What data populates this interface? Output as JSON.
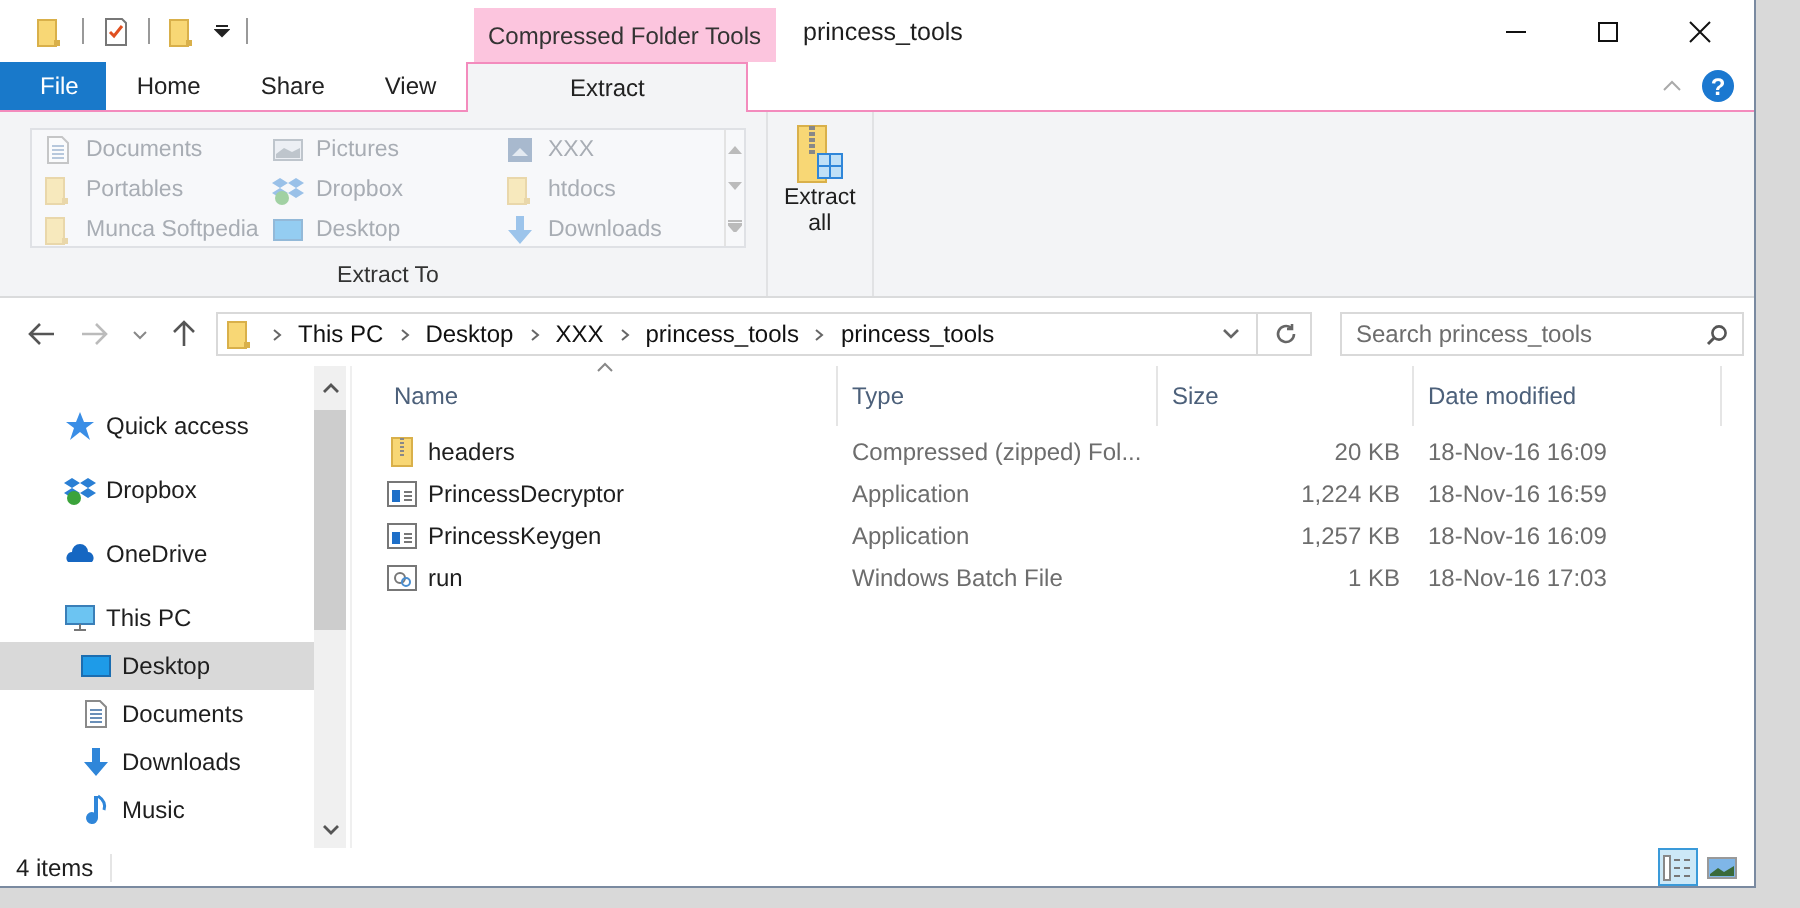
{
  "window": {
    "title": "princess_tools",
    "context_tab_group": "Compressed Folder Tools"
  },
  "quick_access_toolbar": [
    {
      "kind": "folder"
    },
    {
      "kind": "properties"
    },
    {
      "kind": "new-folder"
    }
  ],
  "help_button": "?",
  "tabs": [
    {
      "label": "File",
      "kind": "file",
      "selected": false
    },
    {
      "label": "Home",
      "kind": "normal",
      "selected": false
    },
    {
      "label": "Share",
      "kind": "normal",
      "selected": false
    },
    {
      "label": "View",
      "kind": "normal",
      "selected": false
    },
    {
      "label": "Extract",
      "kind": "context",
      "selected": true
    }
  ],
  "ribbon": {
    "gallery_label": "Extract To",
    "gallery": [
      {
        "label": "Documents",
        "kind": "document",
        "disabled": true
      },
      {
        "label": "Portables",
        "kind": "folder",
        "disabled": true
      },
      {
        "label": "Munca Softpedia",
        "kind": "folder",
        "disabled": true
      },
      {
        "label": "Pictures",
        "kind": "pictures",
        "disabled": true
      },
      {
        "label": "Dropbox",
        "kind": "dropbox",
        "disabled": true
      },
      {
        "label": "Desktop",
        "kind": "desktop",
        "disabled": true
      },
      {
        "label": "XXX",
        "kind": "drive",
        "disabled": true
      },
      {
        "label": "htdocs",
        "kind": "folder",
        "disabled": true
      },
      {
        "label": "Downloads",
        "kind": "download",
        "disabled": true
      }
    ],
    "extract_all": "Extract\nall"
  },
  "address_bar": {
    "path": [
      "This PC",
      "Desktop",
      "XXX",
      "princess_tools",
      "princess_tools"
    ]
  },
  "search": {
    "placeholder": "Search princess_tools"
  },
  "sidebar": {
    "items": [
      {
        "label": "Quick access",
        "kind": "star",
        "selected": false
      },
      {
        "label": "Dropbox",
        "kind": "dropbox",
        "selected": false
      },
      {
        "label": "OneDrive",
        "kind": "cloud",
        "selected": false
      },
      {
        "label": "This PC",
        "kind": "pc",
        "selected": false,
        "children": [
          {
            "label": "Desktop",
            "kind": "desktop",
            "selected": true
          },
          {
            "label": "Documents",
            "kind": "document",
            "selected": false
          },
          {
            "label": "Downloads",
            "kind": "download",
            "selected": false
          },
          {
            "label": "Music",
            "kind": "music",
            "selected": false
          }
        ]
      }
    ]
  },
  "table": {
    "columns": [
      {
        "label": "Name",
        "sorted": true
      },
      {
        "label": "Type",
        "sorted": false
      },
      {
        "label": "Size",
        "sorted": false
      },
      {
        "label": "Date modified",
        "sorted": false
      }
    ],
    "rows": [
      {
        "name": "headers",
        "kind": "zip",
        "type": "Compressed (zipped) Fol...",
        "size": "20 KB",
        "date": "18-Nov-16 16:09"
      },
      {
        "name": "PrincessDecryptor",
        "kind": "app",
        "type": "Application",
        "size": "1,224 KB",
        "date": "18-Nov-16 16:59"
      },
      {
        "name": "PrincessKeygen",
        "kind": "app",
        "type": "Application",
        "size": "1,257 KB",
        "date": "18-Nov-16 16:09"
      },
      {
        "name": "run",
        "kind": "batch",
        "type": "Windows Batch File",
        "size": "1 KB",
        "date": "18-Nov-16 17:03"
      }
    ]
  },
  "status_bar": {
    "text": "4 items",
    "views": [
      {
        "kind": "details",
        "selected": true
      },
      {
        "kind": "large-icons",
        "selected": false
      }
    ]
  }
}
